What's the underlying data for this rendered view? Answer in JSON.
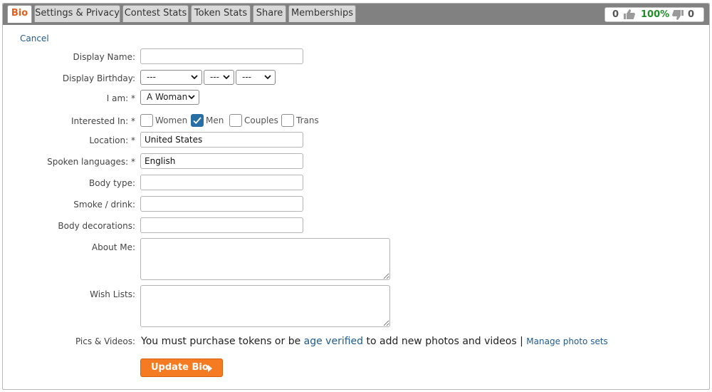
{
  "tabs": [
    {
      "label": "Bio",
      "active": true
    },
    {
      "label": "Settings & Privacy"
    },
    {
      "label": "Contest Stats"
    },
    {
      "label": "Token Stats"
    },
    {
      "label": "Share"
    },
    {
      "label": "Memberships"
    }
  ],
  "stats": {
    "up_count": "0",
    "percent": "100%",
    "down_count": "0"
  },
  "cancel_label": "Cancel",
  "form": {
    "display_name": {
      "label": "Display Name:",
      "value": ""
    },
    "display_birthday": {
      "label": "Display Birthday:",
      "month": "---",
      "day": "---",
      "year": "---"
    },
    "i_am": {
      "label": "I am: *",
      "value": "A Woman"
    },
    "interested_in": {
      "label": "Interested In: *",
      "options": [
        {
          "label": "Women",
          "checked": false
        },
        {
          "label": "Men",
          "checked": true
        },
        {
          "label": "Couples",
          "checked": false
        },
        {
          "label": "Trans",
          "checked": false
        }
      ]
    },
    "location": {
      "label": "Location: *",
      "value": "United States"
    },
    "spoken_languages": {
      "label": "Spoken languages: *",
      "value": "English"
    },
    "body_type": {
      "label": "Body type:",
      "value": ""
    },
    "smoke_drink": {
      "label": "Smoke / drink:",
      "value": ""
    },
    "body_decorations": {
      "label": "Body decorations:",
      "value": ""
    },
    "about_me": {
      "label": "About Me:",
      "value": ""
    },
    "wish_lists": {
      "label": "Wish Lists:",
      "value": ""
    },
    "pics_videos": {
      "label": "Pics & Videos:",
      "text_before": "You must purchase tokens or be ",
      "link_text": "age verified",
      "text_after": " to add new photos and videos | ",
      "manage_link": "Manage photo sets"
    }
  },
  "update_button_label": "Update Bio",
  "colors": {
    "accent": "#f47b22",
    "active_tab_text": "#e2601b",
    "link": "#1e5b8e",
    "percent_green": "#1f8f26",
    "checkbox_checked": "#276fa5"
  }
}
